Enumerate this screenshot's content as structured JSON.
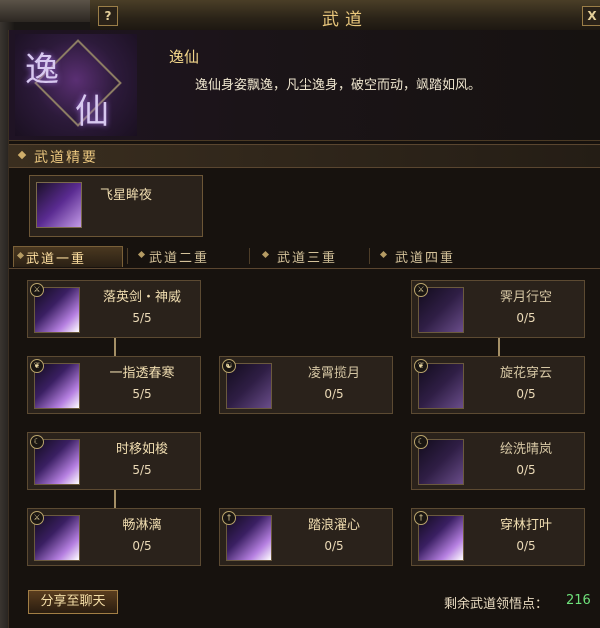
{
  "window": {
    "title": "武道",
    "help_label": "?",
    "close_label": "X"
  },
  "header": {
    "emblem_chars": [
      "逸",
      "仙"
    ],
    "skill_name": "逸仙",
    "description": "逸仙身姿飘逸，凡尘逸身，破空而动，飒踏如风。"
  },
  "essence": {
    "section_title": "武道精要",
    "card": {
      "name": "飞星眸夜",
      "icon": "flying-star-icon"
    }
  },
  "tabs": [
    {
      "label": "武道一重",
      "active": true
    },
    {
      "label": "武道二重",
      "active": false
    },
    {
      "label": "武道三重",
      "active": false
    },
    {
      "label": "武道四重",
      "active": false
    }
  ],
  "nodes": {
    "r1c1": {
      "name": "落英剑・神威",
      "points": "5/5",
      "icon": "sword-slash-icon",
      "badge": "weapon-badge"
    },
    "r1c3": {
      "name": "霁月行空",
      "points": "0/5",
      "icon": "shadow-figure-icon",
      "badge": "weapon-badge"
    },
    "r2c1": {
      "name": "一指透春寒",
      "points": "5/5",
      "icon": "finger-strike-icon",
      "badge": "leaf-badge"
    },
    "r2c2": {
      "name": "凌霄揽月",
      "points": "0/5",
      "icon": "moon-swirl-icon",
      "badge": "yin-yang-badge"
    },
    "r2c3": {
      "name": "旋花穿云",
      "points": "0/5",
      "icon": "petal-spin-icon",
      "badge": "leaf-badge"
    },
    "r3c1": {
      "name": "时移如梭",
      "points": "5/5",
      "icon": "time-shift-icon",
      "badge": "crescent-badge"
    },
    "r3c3": {
      "name": "绘洗晴岚",
      "points": "0/5",
      "icon": "mist-icon",
      "badge": "crescent-badge"
    },
    "r4c1": {
      "name": "畅淋漓",
      "points": "0/5",
      "icon": "rain-slash-icon",
      "badge": "weapon-badge"
    },
    "r4c2": {
      "name": "踏浪濯心",
      "points": "0/5",
      "icon": "wave-step-icon",
      "badge": "sword-badge"
    },
    "r4c3": {
      "name": "穿林打叶",
      "points": "0/5",
      "icon": "leaf-strike-icon",
      "badge": "sword-badge"
    }
  },
  "footer": {
    "share_label": "分享至聊天",
    "remaining_label": "剩余武道领悟点：",
    "remaining_value": "216"
  },
  "colors": {
    "title_gold": "#e9c77c",
    "remaining_green": "#6ee07a",
    "card_bg": "#2a221b",
    "card_border": "#5c4a32"
  }
}
